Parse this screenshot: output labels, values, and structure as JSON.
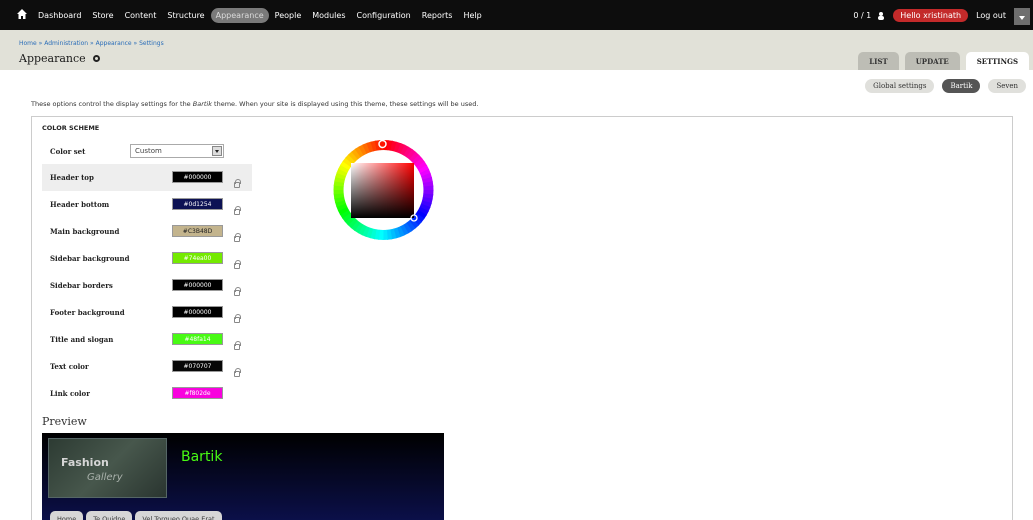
{
  "toolbar": {
    "menu": [
      "Dashboard",
      "Store",
      "Content",
      "Structure",
      "Appearance",
      "People",
      "Modules",
      "Configuration",
      "Reports",
      "Help"
    ],
    "active": "Appearance",
    "counter": "0 / 1",
    "hello": "Hello xristinath",
    "logout": "Log out"
  },
  "header": {
    "breadcrumb": "Home » Administration » Appearance » Settings",
    "title": "Appearance",
    "tabs": [
      "LIST",
      "UPDATE",
      "SETTINGS"
    ],
    "active_tab": "SETTINGS"
  },
  "subtabs": {
    "items": [
      "Global settings",
      "Bartik",
      "Seven"
    ],
    "active": "Bartik"
  },
  "intro": {
    "before": "These options control the display settings for the ",
    "theme": "Bartik",
    "after": " theme. When your site is displayed using this theme, these settings will be used."
  },
  "color_scheme": {
    "legend": "COLOR SCHEME",
    "color_set_label": "Color set",
    "color_set_value": "Custom",
    "rows": [
      {
        "label": "Header top",
        "value": "#000000",
        "bg": "#000000",
        "fg": "#ffffff"
      },
      {
        "label": "Header bottom",
        "value": "#0d1254",
        "bg": "#0d1254",
        "fg": "#ffffff"
      },
      {
        "label": "Main background",
        "value": "#C3B48D",
        "bg": "#c3b48d",
        "fg": "#222222"
      },
      {
        "label": "Sidebar background",
        "value": "#74ea00",
        "bg": "#74ea00",
        "fg": "#ffffff"
      },
      {
        "label": "Sidebar borders",
        "value": "#000000",
        "bg": "#000000",
        "fg": "#ffffff"
      },
      {
        "label": "Footer background",
        "value": "#000000",
        "bg": "#000000",
        "fg": "#ffffff"
      },
      {
        "label": "Title and slogan",
        "value": "#48fa14",
        "bg": "#48fa14",
        "fg": "#ffffff"
      },
      {
        "label": "Text color",
        "value": "#070707",
        "bg": "#070707",
        "fg": "#ffffff"
      },
      {
        "label": "Link color",
        "value": "#f802de",
        "bg": "#f802de",
        "fg": "#ffffff"
      }
    ]
  },
  "preview": {
    "title": "Preview",
    "logo_line1": "Fashion",
    "logo_line2": "Gallery",
    "site_name": "Bartik",
    "nav": [
      "Home",
      "Te Quidne",
      "Vel Torqueo Quae Erat"
    ]
  },
  "icons": [
    "home-icon",
    "user-icon",
    "gear-icon",
    "lock-icon",
    "dropdown-arrow-icon",
    "color-wheel"
  ]
}
